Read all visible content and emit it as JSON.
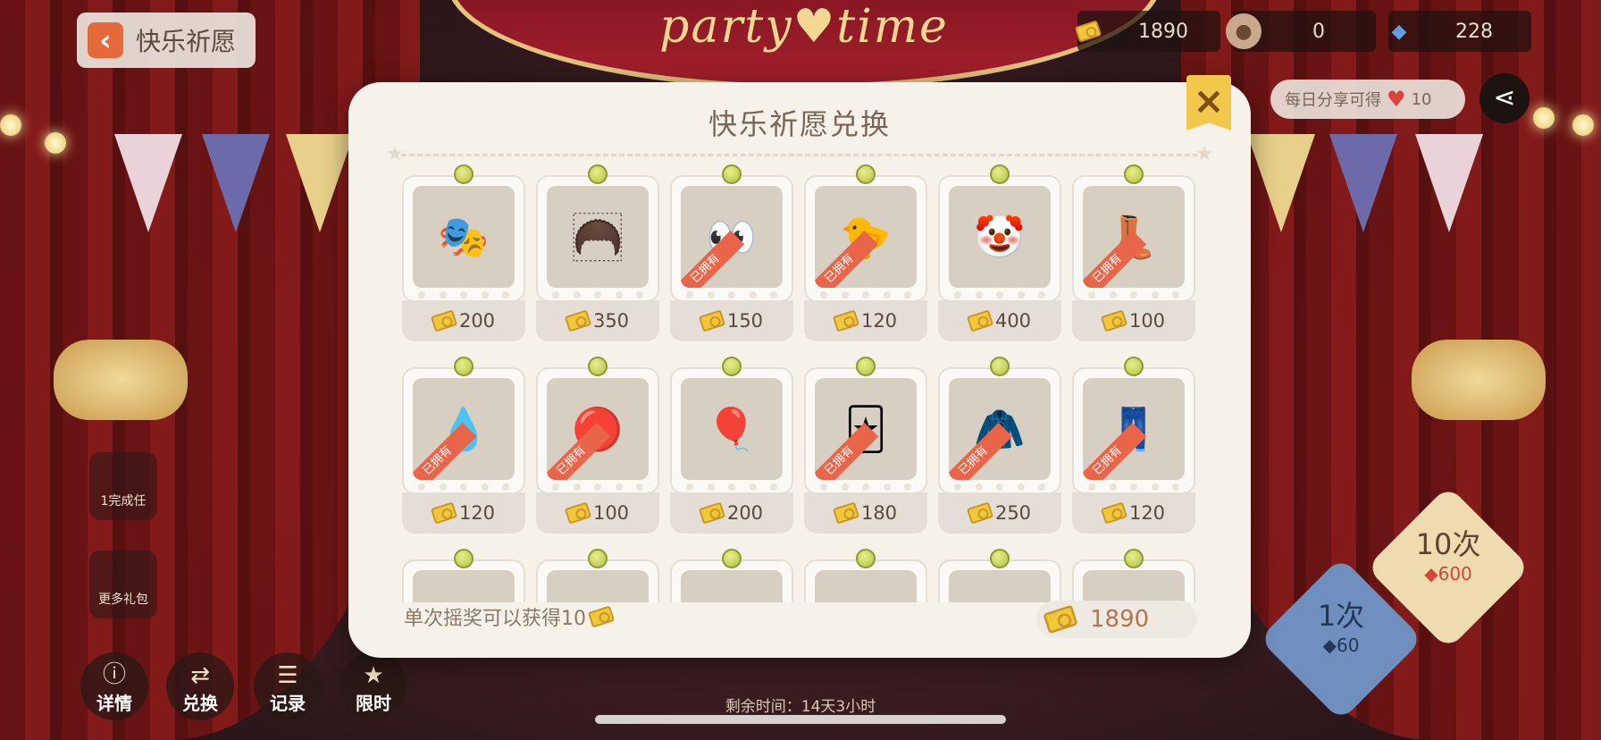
{
  "header": {
    "back_label": "快乐祈愿",
    "banner_text": "party♥time"
  },
  "currencies": [
    {
      "icon": "ticket-icon",
      "value": "1890"
    },
    {
      "icon": "coin-icon",
      "value": "0"
    },
    {
      "icon": "diamond-icon",
      "value": "228"
    }
  ],
  "share": {
    "text": "每日分享可得",
    "amount": "10"
  },
  "modal": {
    "title": "快乐祈愿兑换",
    "note": "单次摇奖可以获得10",
    "balance": "1890",
    "owned_label": "已拥有",
    "items": [
      {
        "price": "200",
        "owned": false,
        "icon": "jester-hat-icon",
        "glyph": "🎭"
      },
      {
        "price": "350",
        "owned": false,
        "icon": "curly-hair-icon",
        "glyph": "🦱"
      },
      {
        "price": "150",
        "owned": true,
        "icon": "eyes-icon",
        "glyph": "👀"
      },
      {
        "price": "120",
        "owned": true,
        "icon": "mouth-icon",
        "glyph": "🐤"
      },
      {
        "price": "400",
        "owned": false,
        "icon": "costume-top-icon",
        "glyph": "🤡"
      },
      {
        "price": "100",
        "owned": true,
        "icon": "boots-icon",
        "glyph": "👢"
      },
      {
        "price": "120",
        "owned": true,
        "icon": "face-paint-icon",
        "glyph": "💧"
      },
      {
        "price": "100",
        "owned": true,
        "icon": "clown-nose-icon",
        "glyph": "🔴"
      },
      {
        "price": "200",
        "owned": false,
        "icon": "balloon-wand-icon",
        "glyph": "🎈"
      },
      {
        "price": "180",
        "owned": true,
        "icon": "playing-cards-icon",
        "glyph": "🃏"
      },
      {
        "price": "250",
        "owned": true,
        "icon": "costume-body-icon",
        "glyph": "🧥"
      },
      {
        "price": "120",
        "owned": true,
        "icon": "pants-icon",
        "glyph": "👖"
      },
      {
        "price": "",
        "owned": false,
        "icon": "item-icon",
        "glyph": ""
      },
      {
        "price": "",
        "owned": false,
        "icon": "item-icon",
        "glyph": ""
      },
      {
        "price": "",
        "owned": false,
        "icon": "item-icon",
        "glyph": ""
      },
      {
        "price": "",
        "owned": false,
        "icon": "item-icon",
        "glyph": ""
      },
      {
        "price": "",
        "owned": false,
        "icon": "item-icon",
        "glyph": ""
      },
      {
        "price": "",
        "owned": false,
        "icon": "item-icon",
        "glyph": ""
      }
    ]
  },
  "side": {
    "task_label": "1完成任",
    "gift_label": "更多礼包"
  },
  "tools": [
    {
      "label": "详情",
      "icon": "info-icon"
    },
    {
      "label": "兑换",
      "icon": "exchange-icon"
    },
    {
      "label": "记录",
      "icon": "record-icon"
    },
    {
      "label": "限时",
      "icon": "limited-icon"
    }
  ],
  "timer_text": "剩余时间：14天3小时",
  "draws": [
    {
      "count": "10次",
      "cost": "600"
    },
    {
      "count": "1次",
      "cost": "60"
    }
  ],
  "colors": {
    "accent_orange": "#e56a3b",
    "owned_tag": "#e8654a",
    "close_yellow": "#f1c84b",
    "balance_text": "#b5744a"
  }
}
